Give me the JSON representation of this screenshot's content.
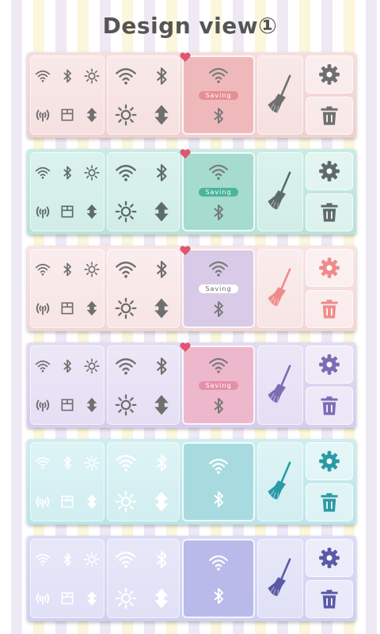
{
  "title": "Design view①",
  "icons": {
    "wifi": "wifi-icon",
    "bluetooth": "bluetooth-icon",
    "brightness": "brightness-icon",
    "signal": "mobile-data-icon",
    "sdcard": "sd-card-icon",
    "sync": "sync-arrows-icon",
    "broom": "broom-icon",
    "gear": "gear-icon",
    "trash": "trash-icon",
    "heart": "heart-icon"
  },
  "widgets": [
    {
      "theme": "pink",
      "bg": "#f6dede",
      "bg2": "#f1cfd0",
      "active_bg": "#efb9bc",
      "icon_color": "#6f6f6f",
      "active_icon": "#ffffff",
      "broom_color": "#6f6f6f",
      "gear_color": "#6f6f6f",
      "saving_label": "Saving",
      "saving_bg": "#e58f95",
      "heart": true
    },
    {
      "theme": "mint",
      "bg": "#c9ece4",
      "bg2": "#b8e3da",
      "active_bg": "#a5dccf",
      "icon_color": "#5e6b68",
      "active_icon": "#ffffff",
      "broom_color": "#5e6b68",
      "gear_color": "#5e6b68",
      "saving_label": "Saving",
      "saving_bg": "#4bb49c",
      "heart": true
    },
    {
      "theme": "peach-lavender",
      "bg": "#f8e4e4",
      "bg2": "#f3d6d6",
      "active_bg": "#d9cbe7",
      "icon_color": "#6f6f6f",
      "active_icon": "#ffffff",
      "broom_color": "#ef8c8a",
      "gear_color": "#ef8c8a",
      "saving_label": "Saving",
      "saving_bg": "#ffffff",
      "heart": true
    },
    {
      "theme": "lavender",
      "bg": "#e2dcf2",
      "bg2": "#d6cdef",
      "active_bg": "#eeb8cc",
      "icon_color": "#6f6f6f",
      "active_icon": "#ffffff",
      "broom_color": "#7d6bb5",
      "gear_color": "#7d6bb5",
      "saving_label": "Saving",
      "saving_bg": "#e58fa8",
      "heart": true
    },
    {
      "theme": "aqua",
      "bg": "#cdeef0",
      "bg2": "#b9e5ea",
      "active_bg": "#a7dbe0",
      "icon_color": "#ffffff",
      "active_icon": "#ffffff",
      "broom_color": "#2a9aa6",
      "gear_color": "#2a9aa6",
      "saving_label": "",
      "saving_bg": "",
      "heart": false
    },
    {
      "theme": "periwinkle",
      "bg": "#dcdcf6",
      "bg2": "#cfd0f2",
      "active_bg": "#b9baea",
      "icon_color": "#ffffff",
      "active_icon": "#ffffff",
      "broom_color": "#5a5aa8",
      "gear_color": "#5a5aa8",
      "saving_label": "",
      "saving_bg": "",
      "heart": false
    }
  ]
}
